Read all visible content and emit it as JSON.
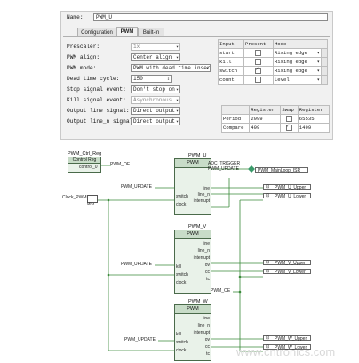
{
  "dialog": {
    "name_label": "Name:",
    "name_value": "PWM_U",
    "tabs": [
      "Configuration",
      "PWM",
      "Built-in"
    ],
    "settings": [
      {
        "label": "Prescaler:",
        "value": "1x",
        "disabled": true
      },
      {
        "label": "PWM align:",
        "value": "Center align",
        "disabled": false
      },
      {
        "label": "PWM mode:",
        "value": "PWM with dead time insert",
        "disabled": false
      },
      {
        "label": "Dead time cycle:",
        "value": "150",
        "disabled": false,
        "spin": true
      },
      {
        "label": "Stop signal event:",
        "value": "Don't stop on",
        "disabled": false
      },
      {
        "label": "Kill signal event:",
        "value": "Asynchronous",
        "disabled": true
      },
      {
        "label": "Output line signal:",
        "value": "Direct output",
        "disabled": false
      },
      {
        "label": "Output line_n signal:",
        "value": "Direct output",
        "disabled": false
      }
    ],
    "inputs_table": {
      "headers": [
        "Input",
        "Present",
        "Mode"
      ],
      "rows": [
        {
          "input": "start",
          "present": false,
          "mode": "Rising edge"
        },
        {
          "input": "kill",
          "present": false,
          "mode": "Rising edge"
        },
        {
          "input": "switch",
          "present": true,
          "mode": "Rising edge"
        },
        {
          "input": "count",
          "present": false,
          "mode": "Level"
        }
      ]
    },
    "register_table": {
      "headers": [
        "",
        "Register",
        "Swap",
        "Register"
      ],
      "rows": [
        {
          "name": "Period",
          "reg1": "2999",
          "swap": false,
          "reg2": "65535"
        },
        {
          "name": "Compare",
          "reg1": "499",
          "swap": true,
          "reg2": "1499"
        }
      ]
    }
  },
  "schematic": {
    "control_reg": {
      "title": "PWM_Ctrl_Reg",
      "head": "Control Reg",
      "pin": "control_0",
      "net": "PWM_OE"
    },
    "clock": {
      "label": "Clock_PWM",
      "unit": "MHz"
    },
    "blocks": [
      {
        "title": "PWM_U",
        "head": "PWM",
        "pins_left": [
          "switch",
          "clock"
        ],
        "pins_right": [
          "line",
          "line_n",
          "interrupt"
        ],
        "net_in": "PWM_UPDATE",
        "outputs": [
          "PWM_U_Upper",
          "PWM_U_Lower"
        ]
      },
      {
        "title": "PWM_V",
        "head": "PWM",
        "pins_left": [
          "kill",
          "switch",
          "clock"
        ],
        "pins_right": [
          "line",
          "line_n",
          "interrupt",
          "ov",
          "cc",
          "tc"
        ],
        "net_in": "PWM_UPDATE",
        "outputs": [
          "PWM_V_Upper",
          "PWM_V_Lower"
        ]
      },
      {
        "title": "PWM_W",
        "head": "PWM",
        "pins_left": [
          "kill",
          "switch",
          "clock"
        ],
        "pins_right": [
          "line",
          "line_n",
          "interrupt",
          "ov",
          "cc",
          "tc"
        ],
        "net_in": "PWM_UPDATE",
        "outputs": [
          "PWM_W_Upper",
          "PWM_W_Lower"
        ]
      }
    ],
    "adc_trigger": "ADC_TRIGGER",
    "pwm_update_out": "PWM_UPDATE",
    "isr": "PWM_MainLoop_ISR",
    "pwm_oe_net": "PWM_OE"
  },
  "watermark": "www.cntronics.com"
}
